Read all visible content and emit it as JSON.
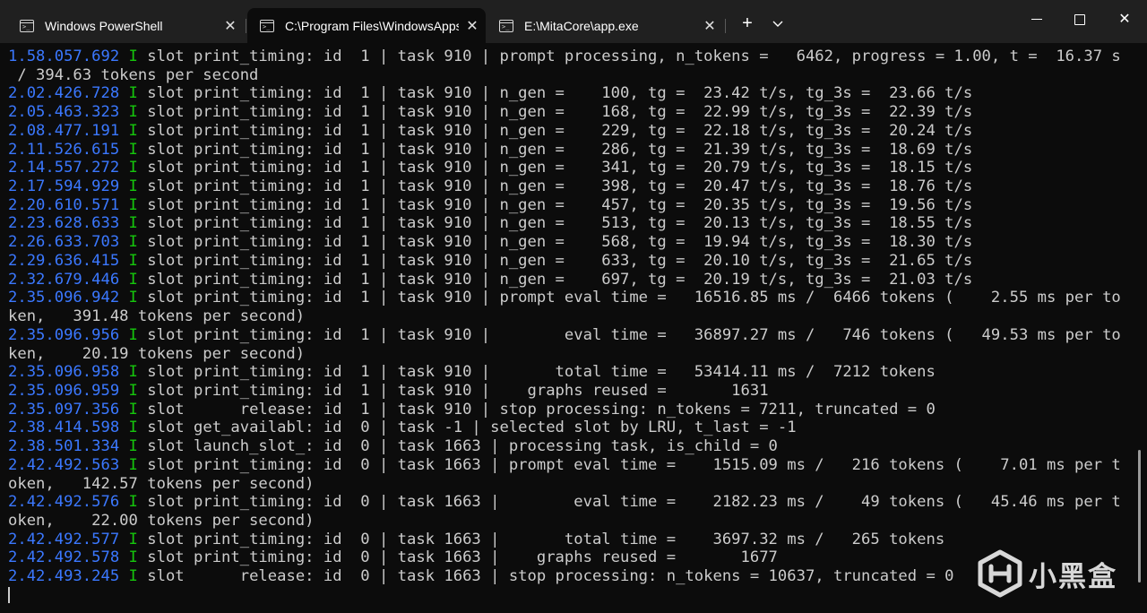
{
  "tabs": [
    {
      "title": "Windows PowerShell",
      "icon": "terminal-icon"
    },
    {
      "title": "C:\\Program Files\\WindowsApps",
      "icon": "terminal-icon",
      "active": true
    },
    {
      "title": "E:\\MitaCore\\app.exe",
      "icon": "terminal-icon"
    }
  ],
  "window_controls": {
    "new_tab": "+",
    "dropdown": "⌄",
    "minimize": "minimize",
    "maximize": "maximize",
    "close": "✕"
  },
  "colors": {
    "background": "#0c0c0c",
    "titlebar": "#202020",
    "timestamp": "#3b78ff",
    "level": "#16c60c",
    "text": "#cccccc"
  },
  "terminal": {
    "lines": [
      {
        "ts": "1.58.057.692",
        "lvl": "I",
        "text": " slot print_timing: id  1 | task 910 | prompt processing, n_tokens =   6462, progress = 1.00, t =  16.37 s"
      },
      {
        "ts": "",
        "lvl": "",
        "text": " / 394.63 tokens per second"
      },
      {
        "ts": "2.02.426.728",
        "lvl": "I",
        "text": " slot print_timing: id  1 | task 910 | n_gen =    100, tg =  23.42 t/s, tg_3s =  23.66 t/s"
      },
      {
        "ts": "2.05.463.323",
        "lvl": "I",
        "text": " slot print_timing: id  1 | task 910 | n_gen =    168, tg =  22.99 t/s, tg_3s =  22.39 t/s"
      },
      {
        "ts": "2.08.477.191",
        "lvl": "I",
        "text": " slot print_timing: id  1 | task 910 | n_gen =    229, tg =  22.18 t/s, tg_3s =  20.24 t/s"
      },
      {
        "ts": "2.11.526.615",
        "lvl": "I",
        "text": " slot print_timing: id  1 | task 910 | n_gen =    286, tg =  21.39 t/s, tg_3s =  18.69 t/s"
      },
      {
        "ts": "2.14.557.272",
        "lvl": "I",
        "text": " slot print_timing: id  1 | task 910 | n_gen =    341, tg =  20.79 t/s, tg_3s =  18.15 t/s"
      },
      {
        "ts": "2.17.594.929",
        "lvl": "I",
        "text": " slot print_timing: id  1 | task 910 | n_gen =    398, tg =  20.47 t/s, tg_3s =  18.76 t/s"
      },
      {
        "ts": "2.20.610.571",
        "lvl": "I",
        "text": " slot print_timing: id  1 | task 910 | n_gen =    457, tg =  20.35 t/s, tg_3s =  19.56 t/s"
      },
      {
        "ts": "2.23.628.633",
        "lvl": "I",
        "text": " slot print_timing: id  1 | task 910 | n_gen =    513, tg =  20.13 t/s, tg_3s =  18.55 t/s"
      },
      {
        "ts": "2.26.633.703",
        "lvl": "I",
        "text": " slot print_timing: id  1 | task 910 | n_gen =    568, tg =  19.94 t/s, tg_3s =  18.30 t/s"
      },
      {
        "ts": "2.29.636.415",
        "lvl": "I",
        "text": " slot print_timing: id  1 | task 910 | n_gen =    633, tg =  20.10 t/s, tg_3s =  21.65 t/s"
      },
      {
        "ts": "2.32.679.446",
        "lvl": "I",
        "text": " slot print_timing: id  1 | task 910 | n_gen =    697, tg =  20.19 t/s, tg_3s =  21.03 t/s"
      },
      {
        "ts": "2.35.096.942",
        "lvl": "I",
        "text": " slot print_timing: id  1 | task 910 | prompt eval time =   16516.85 ms /  6466 tokens (    2.55 ms per to"
      },
      {
        "ts": "",
        "lvl": "",
        "text": "ken,   391.48 tokens per second)"
      },
      {
        "ts": "2.35.096.956",
        "lvl": "I",
        "text": " slot print_timing: id  1 | task 910 |        eval time =   36897.27 ms /   746 tokens (   49.53 ms per to"
      },
      {
        "ts": "",
        "lvl": "",
        "text": "ken,    20.19 tokens per second)"
      },
      {
        "ts": "2.35.096.958",
        "lvl": "I",
        "text": " slot print_timing: id  1 | task 910 |       total time =   53414.11 ms /  7212 tokens"
      },
      {
        "ts": "2.35.096.959",
        "lvl": "I",
        "text": " slot print_timing: id  1 | task 910 |    graphs reused =       1631"
      },
      {
        "ts": "2.35.097.356",
        "lvl": "I",
        "text": " slot      release: id  1 | task 910 | stop processing: n_tokens = 7211, truncated = 0"
      },
      {
        "ts": "2.38.414.598",
        "lvl": "I",
        "text": " slot get_availabl: id  0 | task -1 | selected slot by LRU, t_last = -1"
      },
      {
        "ts": "2.38.501.334",
        "lvl": "I",
        "text": " slot launch_slot_: id  0 | task 1663 | processing task, is_child = 0"
      },
      {
        "ts": "2.42.492.563",
        "lvl": "I",
        "text": " slot print_timing: id  0 | task 1663 | prompt eval time =    1515.09 ms /   216 tokens (    7.01 ms per t"
      },
      {
        "ts": "",
        "lvl": "",
        "text": "oken,   142.57 tokens per second)"
      },
      {
        "ts": "2.42.492.576",
        "lvl": "I",
        "text": " slot print_timing: id  0 | task 1663 |        eval time =    2182.23 ms /    49 tokens (   45.46 ms per t"
      },
      {
        "ts": "",
        "lvl": "",
        "text": "oken,    22.00 tokens per second)"
      },
      {
        "ts": "2.42.492.577",
        "lvl": "I",
        "text": " slot print_timing: id  0 | task 1663 |       total time =    3697.32 ms /   265 tokens"
      },
      {
        "ts": "2.42.492.578",
        "lvl": "I",
        "text": " slot print_timing: id  0 | task 1663 |    graphs reused =       1677"
      },
      {
        "ts": "2.42.493.245",
        "lvl": "I",
        "text": " slot      release: id  0 | task 1663 | stop processing: n_tokens = 10637, truncated = 0"
      }
    ]
  },
  "watermark": {
    "text": "小黑盒",
    "icon": "heybox-logo-icon"
  }
}
